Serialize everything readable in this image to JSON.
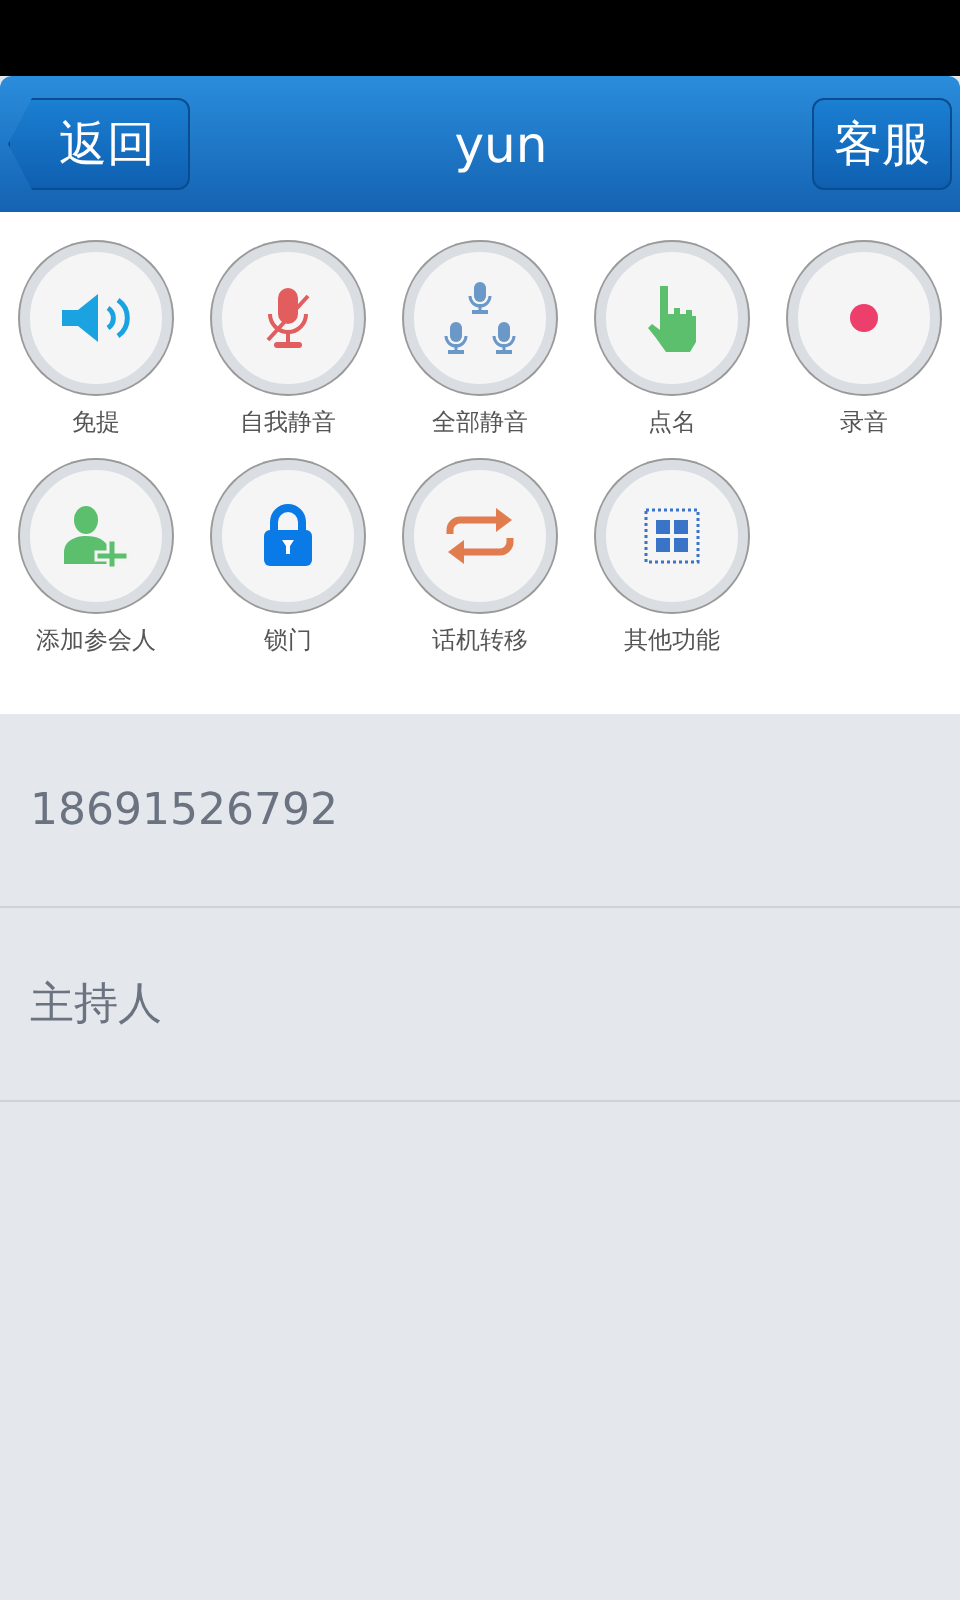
{
  "header": {
    "back": "返回",
    "title": "yun",
    "service": "客服"
  },
  "actions": [
    {
      "label": "免提"
    },
    {
      "label": "自我静音"
    },
    {
      "label": "全部静音"
    },
    {
      "label": "点名"
    },
    {
      "label": "录音"
    },
    {
      "label": "添加参会人"
    },
    {
      "label": "锁门"
    },
    {
      "label": "话机转移"
    },
    {
      "label": "其他功能"
    }
  ],
  "participants": [
    {
      "text": "18691526792"
    },
    {
      "text": "主持人"
    }
  ]
}
